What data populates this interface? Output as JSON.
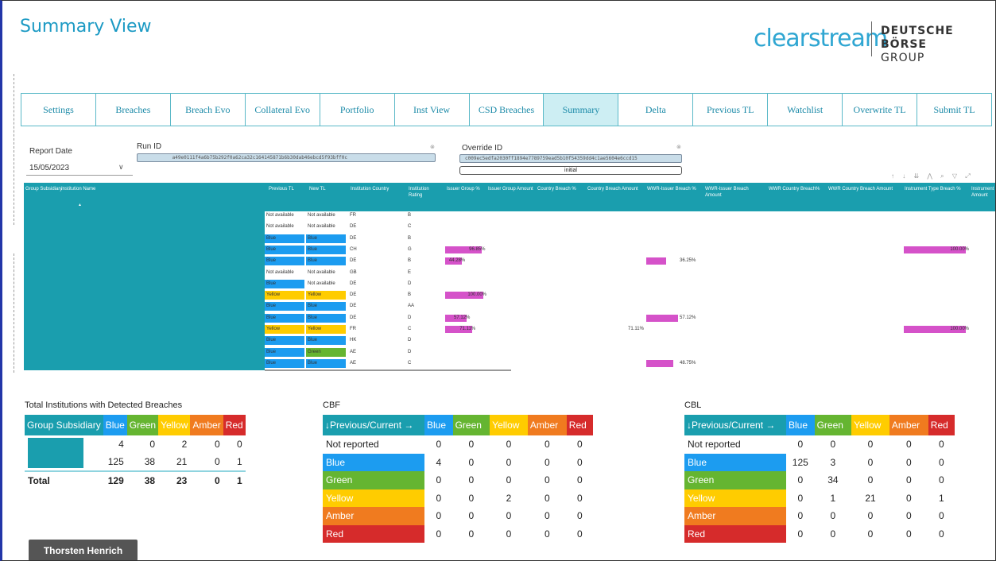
{
  "title": "Summary View",
  "logo": {
    "brand": "clearstream",
    "group_line1": "DEUTSCHE BÖRSE",
    "group_line2": "GROUP"
  },
  "tabs": [
    {
      "label": "Settings"
    },
    {
      "label": "Breaches"
    },
    {
      "label": "Breach Evo"
    },
    {
      "label": "Collateral Evo"
    },
    {
      "label": "Portfolio"
    },
    {
      "label": "Inst View"
    },
    {
      "label": "CSD Breaches"
    },
    {
      "label": "Summary"
    },
    {
      "label": "Delta"
    },
    {
      "label": "Previous TL"
    },
    {
      "label": "Watchlist"
    },
    {
      "label": "Overwrite TL"
    },
    {
      "label": "Submit TL"
    }
  ],
  "active_tab": "Summary",
  "filters": {
    "report_date_label": "Report Date",
    "report_date_value": "15/05/2023",
    "run_id_label": "Run ID",
    "run_id_value": "a49e0111f4a6b75b292f0a62ca32c164145871b6b30dab46ebcd5f93bff0c",
    "override_id_label": "Override ID",
    "override_id_value": "c009ec5edfa2030ff1894e7789759ead5b10f54359dd4c1ae5604e6ccd15",
    "override_select": "initial"
  },
  "breach_table": {
    "headers": [
      "Group Subsidiary",
      "Institution Name",
      "Previous TL",
      "New TL",
      "Institution Country",
      "Institution Rating",
      "Issuer Group %",
      "Issuer Group Amount",
      "Country Breach %",
      "Country Breach Amount",
      "WWR-Issuer Breach %",
      "WWR-Issuer Breach Amount",
      "WWR Country Breach%",
      "WWR Country Breach Amount",
      "Instrument Type Breach %",
      "Instrument Amount"
    ],
    "rows": [
      {
        "prev": "Not available",
        "new": "Not available",
        "country": "FR",
        "rating": "B",
        "prev_color": "",
        "new_color": "",
        "issuer": "",
        "wwr": "",
        "instr": "",
        "country_pct": ""
      },
      {
        "prev": "Not available",
        "new": "Not available",
        "country": "DE",
        "rating": "C",
        "prev_color": "",
        "new_color": "",
        "issuer": "",
        "wwr": "",
        "instr": "",
        "country_pct": ""
      },
      {
        "prev": "Blue",
        "new": "Blue",
        "country": "DE",
        "rating": "B",
        "prev_color": "blue",
        "new_color": "blue",
        "issuer": "",
        "wwr": "",
        "instr": "",
        "country_pct": ""
      },
      {
        "prev": "Blue",
        "new": "Blue",
        "country": "CH",
        "rating": "G",
        "prev_color": "blue",
        "new_color": "blue",
        "issuer": "96.85%",
        "wwr": "",
        "instr": "100.00%",
        "country_pct": ""
      },
      {
        "prev": "Blue",
        "new": "Blue",
        "country": "DE",
        "rating": "B",
        "prev_color": "blue",
        "new_color": "blue",
        "issuer": "44.28%",
        "wwr": "36.25%",
        "instr": "",
        "country_pct": ""
      },
      {
        "prev": "Not available",
        "new": "Not available",
        "country": "GB",
        "rating": "E",
        "prev_color": "",
        "new_color": "",
        "issuer": "",
        "wwr": "",
        "instr": "",
        "country_pct": ""
      },
      {
        "prev": "Blue",
        "new": "Not available",
        "country": "DE",
        "rating": "D",
        "prev_color": "blue",
        "new_color": "",
        "issuer": "",
        "wwr": "",
        "instr": "",
        "country_pct": ""
      },
      {
        "prev": "Yellow",
        "new": "Yellow",
        "country": "DE",
        "rating": "B",
        "prev_color": "yellow",
        "new_color": "yellow",
        "issuer": "100.00%",
        "wwr": "",
        "instr": "",
        "country_pct": ""
      },
      {
        "prev": "Blue",
        "new": "Blue",
        "country": "DE",
        "rating": "AA",
        "prev_color": "blue",
        "new_color": "blue",
        "issuer": "",
        "wwr": "",
        "instr": "",
        "country_pct": ""
      },
      {
        "prev": "Blue",
        "new": "Blue",
        "country": "DE",
        "rating": "D",
        "prev_color": "blue",
        "new_color": "blue",
        "issuer": "57.12%",
        "wwr": "57.12%",
        "instr": "",
        "country_pct": ""
      },
      {
        "prev": "Yellow",
        "new": "Yellow",
        "country": "FR",
        "rating": "C",
        "prev_color": "yellow",
        "new_color": "yellow",
        "issuer": "71.11%",
        "wwr": "",
        "instr": "100.00%",
        "country_pct": "71.11%"
      },
      {
        "prev": "Blue",
        "new": "Blue",
        "country": "HK",
        "rating": "D",
        "prev_color": "blue",
        "new_color": "blue",
        "issuer": "",
        "wwr": "",
        "instr": "",
        "country_pct": ""
      },
      {
        "prev": "Blue",
        "new": "Green",
        "country": "AE",
        "rating": "D",
        "prev_color": "blue",
        "new_color": "green",
        "issuer": "",
        "wwr": "",
        "instr": "",
        "country_pct": ""
      },
      {
        "prev": "Blue",
        "new": "Blue",
        "country": "AE",
        "rating": "C",
        "prev_color": "blue",
        "new_color": "blue",
        "issuer": "",
        "wwr": "48.75%",
        "instr": "",
        "country_pct": ""
      }
    ]
  },
  "totals": {
    "title": "Total Institutions with Detected Breaches",
    "headers": [
      "Group Subsidiary",
      "Blue",
      "Green",
      "Yellow",
      "Amber",
      "Red"
    ],
    "rows": [
      {
        "values": [
          "4",
          "0",
          "2",
          "0",
          "0"
        ]
      },
      {
        "values": [
          "125",
          "38",
          "21",
          "0",
          "1"
        ]
      }
    ],
    "total_label": "Total",
    "total_values": [
      "129",
      "38",
      "23",
      "0",
      "1"
    ]
  },
  "cbf": {
    "title": "CBF",
    "corner": "↓Previous/Current →",
    "headers": [
      "Blue",
      "Green",
      "Yellow",
      "Amber",
      "Red"
    ],
    "rows": [
      {
        "label": "Not reported",
        "values": [
          "0",
          "0",
          "0",
          "0",
          "0"
        ]
      },
      {
        "label": "Blue",
        "values": [
          "4",
          "0",
          "0",
          "0",
          "0"
        ]
      },
      {
        "label": "Green",
        "values": [
          "0",
          "0",
          "0",
          "0",
          "0"
        ]
      },
      {
        "label": "Yellow",
        "values": [
          "0",
          "0",
          "2",
          "0",
          "0"
        ]
      },
      {
        "label": "Amber",
        "values": [
          "0",
          "0",
          "0",
          "0",
          "0"
        ]
      },
      {
        "label": "Red",
        "values": [
          "0",
          "0",
          "0",
          "0",
          "0"
        ]
      }
    ]
  },
  "cbl": {
    "title": "CBL",
    "corner": "↓Previous/Current →",
    "headers": [
      "Blue",
      "Green",
      "Yellow",
      "Amber",
      "Red"
    ],
    "rows": [
      {
        "label": "Not reported",
        "values": [
          "0",
          "0",
          "0",
          "0",
          "0"
        ]
      },
      {
        "label": "Blue",
        "values": [
          "125",
          "3",
          "0",
          "0",
          "0"
        ]
      },
      {
        "label": "Green",
        "values": [
          "0",
          "34",
          "0",
          "0",
          "0"
        ]
      },
      {
        "label": "Yellow",
        "values": [
          "0",
          "1",
          "21",
          "0",
          "1"
        ]
      },
      {
        "label": "Amber",
        "values": [
          "0",
          "0",
          "0",
          "0",
          "0"
        ]
      },
      {
        "label": "Red",
        "values": [
          "0",
          "0",
          "0",
          "0",
          "0"
        ]
      }
    ]
  },
  "user_badge": "Thorsten Henrich",
  "colors": {
    "teal": "#1a9eae",
    "blue": "#1c9cf0",
    "green": "#65b531",
    "yellow": "#ffcc00",
    "amber": "#f07b1f",
    "red": "#d62b2b",
    "bar": "#d552c9",
    "title": "#1c9ac4"
  }
}
